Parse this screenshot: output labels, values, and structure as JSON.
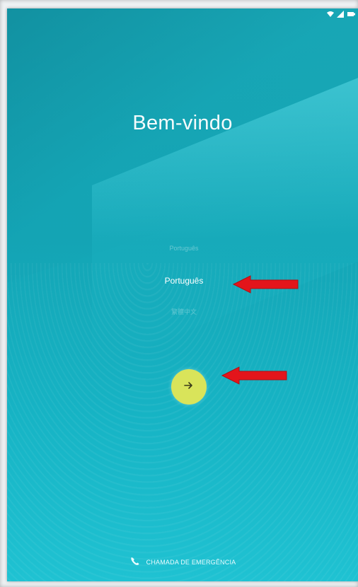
{
  "welcome": {
    "title": "Bem-vindo"
  },
  "language_picker": {
    "previous": "Português",
    "selected": "Português",
    "next": "繁體中文"
  },
  "next_button": {
    "icon": "arrow-right-icon"
  },
  "emergency": {
    "label": "CHAMADA DE EMERGÊNCIA",
    "icon": "phone-icon"
  },
  "status_bar": {
    "icons": [
      "wifi-icon",
      "signal-icon",
      "battery-icon"
    ]
  },
  "annotations": {
    "arrow_color": "#e3151b"
  },
  "colors": {
    "next_button": "#d9e45a",
    "background": "#14a5b5"
  }
}
